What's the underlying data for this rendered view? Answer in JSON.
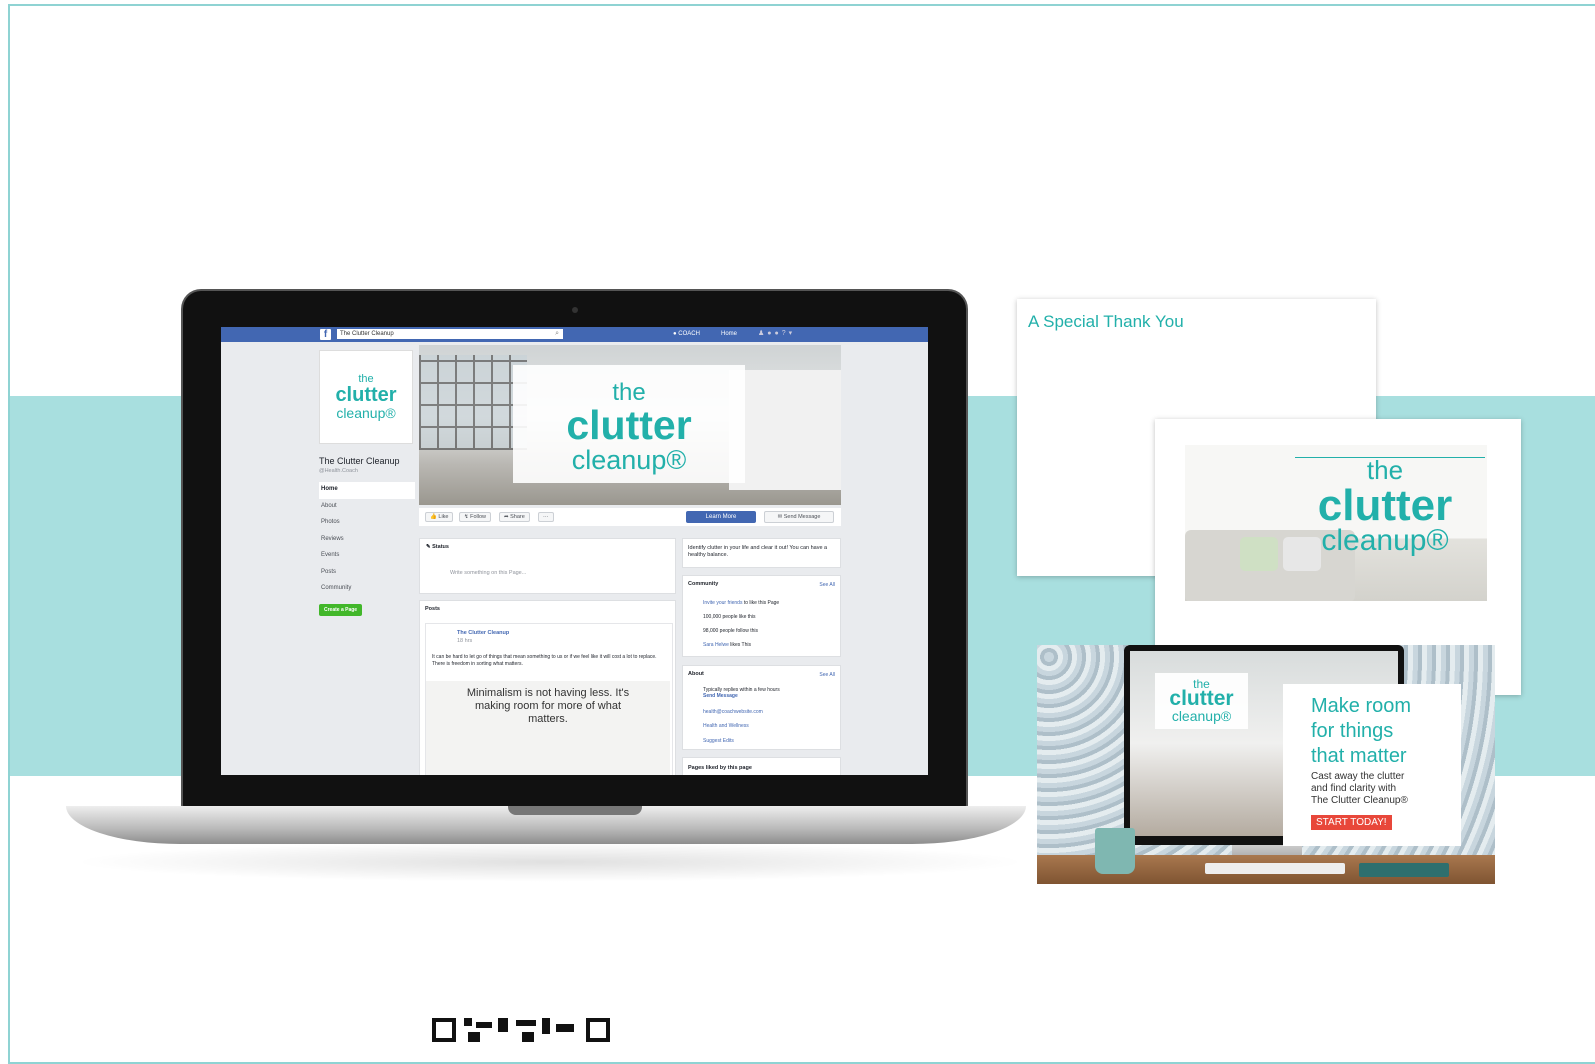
{
  "colors": {
    "teal": "#22b0aa",
    "band": "#a8dfdf",
    "facebook_blue": "#4267b2",
    "cta_red": "#e8473a"
  },
  "facebook": {
    "search_value": "The Clutter Cleanup",
    "user_label": "COACH",
    "home_label": "Home",
    "page_name": "The Clutter Cleanup",
    "page_handle": "@Health.Coach",
    "nav": [
      "Home",
      "About",
      "Photos",
      "Reviews",
      "Events",
      "Posts",
      "Community"
    ],
    "create_page": "Create a Page",
    "cover_logo": {
      "the": "the",
      "clutter": "clutter",
      "cleanup": "cleanup®"
    },
    "actions": {
      "like": "Like",
      "follow": "Follow",
      "share": "Share",
      "more": "···",
      "learn_more": "Learn More",
      "send_message": "Send Message"
    },
    "status": {
      "label": "Status",
      "placeholder": "Write something on this Page..."
    },
    "posts_header": "Posts",
    "post": {
      "author": "The Clutter Cleanup",
      "time": "18 hrs",
      "text": "It can be hard to let go of things that mean something to us or if we feel like it will cost a lot to replace. There is freedom in sorting what matters.",
      "quote": "Minimalism is not having less. It's making room for more of what matters."
    },
    "intro": "Identify clutter in your life and clear it out! You can have a healthy balance.",
    "community": {
      "title": "Community",
      "see_all": "See All",
      "rows": [
        {
          "link": "Invite your friends",
          "text": "to like this Page"
        },
        {
          "link": "",
          "text": "100,000 people like this"
        },
        {
          "link": "",
          "text": "98,000 people follow this"
        },
        {
          "link": "Sara Helwe",
          "text": "likes This"
        }
      ]
    },
    "about": {
      "title": "About",
      "see_all": "See All",
      "rows": [
        {
          "text": "Typically replies within a few hours",
          "link": "Send Message"
        },
        {
          "text": "",
          "link": "health@coachwebsite.com"
        },
        {
          "text": "",
          "link": "Health and Wellness"
        },
        {
          "text": "",
          "link": "Suggest Edits"
        }
      ]
    },
    "pages_liked": "Pages liked by this page"
  },
  "thank_you_card": {
    "title": "A Special Thank You"
  },
  "logo": {
    "the": "the",
    "clutter": "clutter",
    "cleanup": "cleanup®"
  },
  "ad": {
    "headline": [
      "Make room",
      "for things",
      "that matter"
    ],
    "sub": [
      "Cast away the clutter",
      "and find clarity with",
      "The Clutter Cleanup®"
    ],
    "cta": "START TODAY!",
    "logo": {
      "the": "the",
      "clutter": "clutter",
      "cleanup": "cleanup®"
    }
  }
}
